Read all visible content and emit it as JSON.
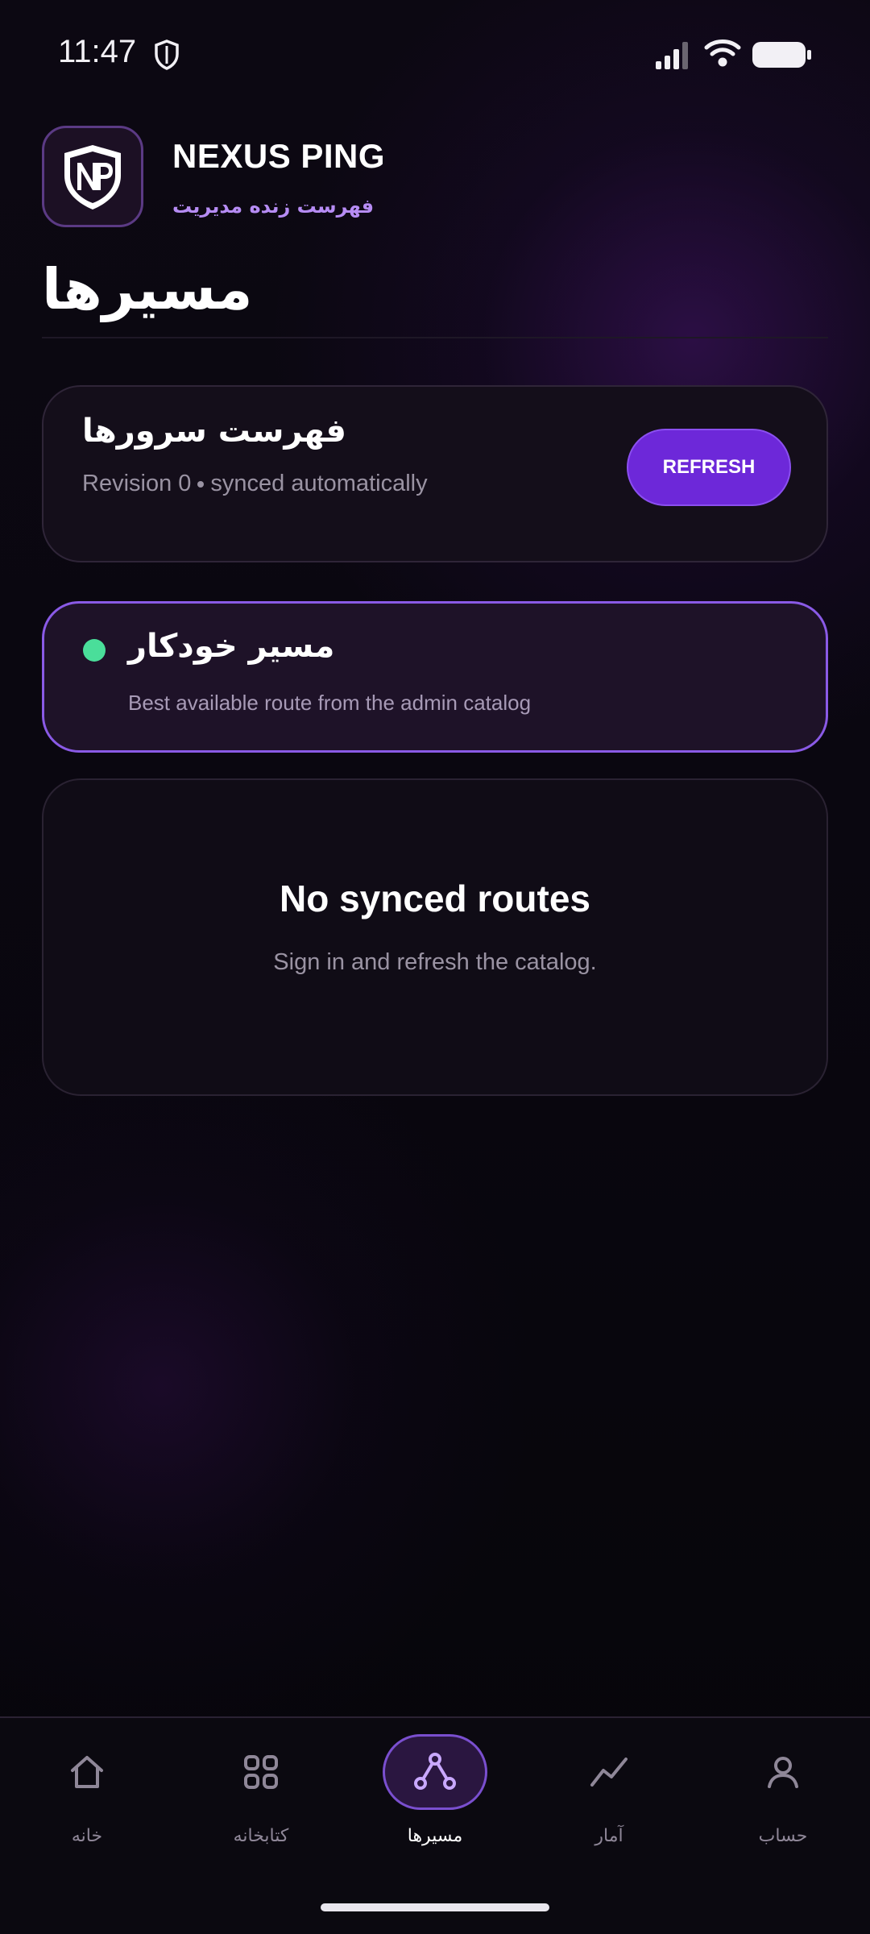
{
  "status_bar": {
    "time": "11:47",
    "icons": [
      "shield-icon",
      "signal-icon",
      "wifi-icon",
      "battery-icon"
    ]
  },
  "header": {
    "logo_icon": "np-shield-logo-icon",
    "app_name": "NEXUS PING",
    "subtitle": "فهرست زنده مدیریت"
  },
  "page": {
    "title": "مسیرها"
  },
  "catalog": {
    "title": "فهرست سرورها",
    "revision": "Revision 0",
    "sync_status": "synced automatically",
    "refresh_label": "REFRESH"
  },
  "auto_route": {
    "title": "مسیر خودکار",
    "description": "Best available route from the admin catalog",
    "status_color": "#4ade9a"
  },
  "empty_state": {
    "title": "No synced routes",
    "description": "Sign in and refresh the catalog."
  },
  "bottom_nav": {
    "items": [
      {
        "label": "خانه",
        "icon": "home-icon",
        "active": false
      },
      {
        "label": "کتابخانه",
        "icon": "grid-icon",
        "active": false
      },
      {
        "label": "مسیرها",
        "icon": "routes-icon",
        "active": true
      },
      {
        "label": "آمار",
        "icon": "chart-icon",
        "active": false
      },
      {
        "label": "حساب",
        "icon": "user-icon",
        "active": false
      }
    ]
  },
  "colors": {
    "accent": "#6d28d9",
    "accent_border": "#8a5ae6",
    "subtitle": "#b68cf4",
    "background": "#0a0710"
  }
}
